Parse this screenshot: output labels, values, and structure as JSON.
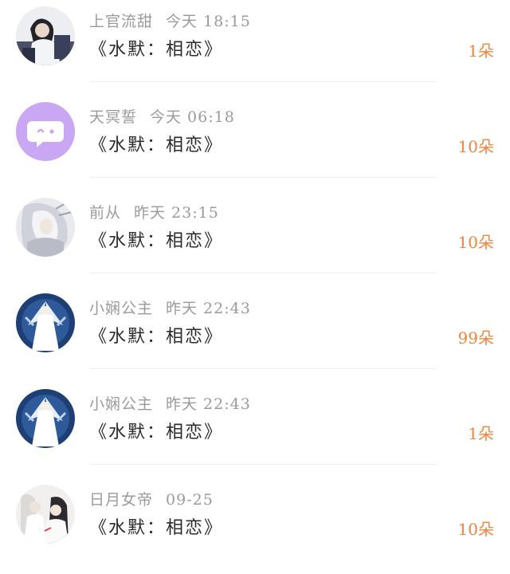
{
  "feed": {
    "items": [
      {
        "name": "上官流甜",
        "time": "今天 18:15",
        "title": "《水默：相恋》",
        "count": "1朵",
        "avatar": "user-photo-avatar"
      },
      {
        "name": "天冥誓",
        "time": "今天 06:18",
        "title": "《水默：相恋》",
        "count": "10朵",
        "avatar": "default-chat-avatar"
      },
      {
        "name": "前从",
        "time": "昨天 23:15",
        "title": "《水默：相恋》",
        "count": "10朵",
        "avatar": "white-hair-character-avatar"
      },
      {
        "name": "小娴公主",
        "time": "昨天 22:43",
        "title": "《水默：相恋》",
        "count": "99朵",
        "avatar": "angel-character-avatar"
      },
      {
        "name": "小娴公主",
        "time": "昨天 22:43",
        "title": "《水默：相恋》",
        "count": "1朵",
        "avatar": "angel-character-avatar"
      },
      {
        "name": "日月女帝",
        "time": "09-25",
        "title": "《水默：相恋》",
        "count": "10朵",
        "avatar": "couple-character-avatar"
      }
    ]
  },
  "colors": {
    "accent": "#f0843a",
    "name_text": "#9a9a9a",
    "title_text": "#2a2a2a",
    "default_avatar_bg": "#c9a7f2"
  }
}
